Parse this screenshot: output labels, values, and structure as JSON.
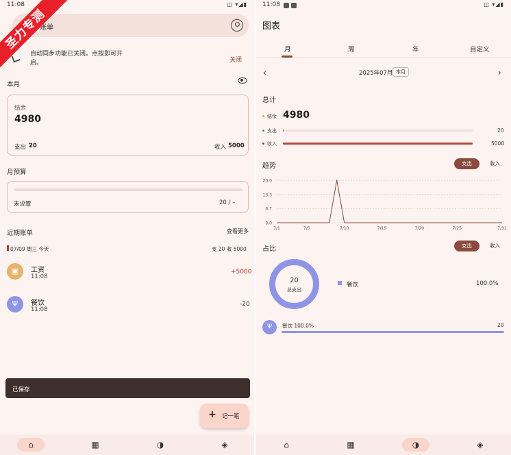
{
  "left": {
    "status_time": "11:08",
    "status_icons": "◫ ▾◢▮",
    "ribbon": "圣力专测",
    "search_text": "账单",
    "sync_note": "自动同步功能已关闭。点按即可开启。",
    "sync_close": "关闭",
    "this_month": "本月",
    "balance": {
      "label": "结余",
      "value": "4980",
      "expense_label": "支出",
      "expense_value": "20",
      "income_label": "收入",
      "income_value": "5000"
    },
    "budget": {
      "title": "月预算",
      "status": "未设置",
      "value": "20 / –",
      "progress": 0
    },
    "recent": {
      "title": "近期账单",
      "see_more": "查看更多",
      "day": "07/09 周三 今天",
      "day_summary": "支 20   收 5000"
    },
    "transactions": [
      {
        "icon": "wallet-icon",
        "glyph": "▣",
        "color": "#e7b36b",
        "name": "工资",
        "time": "11:08",
        "amount": "+5000",
        "amount_color": "#b3322f"
      },
      {
        "icon": "fork-knife-icon",
        "glyph": "Ψ",
        "color": "#8f95e6",
        "name": "餐饮",
        "time": "11:08",
        "amount": "-20",
        "amount_color": "#333333"
      }
    ],
    "snackbar": "已保存",
    "fab": {
      "plus": "+",
      "label": "记一笔"
    },
    "nav": [
      {
        "icon": "home-icon",
        "glyph": "⌂"
      },
      {
        "icon": "calendar-icon",
        "glyph": "▦"
      },
      {
        "icon": "chart-icon",
        "glyph": "◑"
      },
      {
        "icon": "layers-icon",
        "glyph": "◈"
      }
    ]
  },
  "right": {
    "status_time": "11:08",
    "status_icons": "◫ ▾◢▮",
    "title": "图表",
    "tabs": [
      {
        "label": "月",
        "active": true
      },
      {
        "label": "周",
        "active": false
      },
      {
        "label": "年",
        "active": false
      },
      {
        "label": "自定义",
        "active": false
      }
    ],
    "month_label": "2025年07月",
    "this_month_btn": "本月",
    "prev_glyph": "‹",
    "next_glyph": "›",
    "total": {
      "title": "总计",
      "balance_label": "结余",
      "balance_value": "4980",
      "expense_label": "支出",
      "expense_value": "20",
      "expense_ratio": 0.004,
      "income_label": "收入",
      "income_value": "5000",
      "income_ratio": 1.0
    },
    "trend": {
      "title": "趋势",
      "pill_on": "支出",
      "pill_off": "收入"
    },
    "share": {
      "title": "占比",
      "pill_on": "支出",
      "pill_off": "收入",
      "donut_value": "20",
      "donut_label": "总支出",
      "legend_name": "餐饮",
      "legend_pct": "100.0%",
      "cat_label": "餐饮  100.0%",
      "cat_value": "20"
    },
    "nav": [
      {
        "icon": "home-icon",
        "glyph": "⌂"
      },
      {
        "icon": "calendar-icon",
        "glyph": "▦"
      },
      {
        "icon": "chart-icon",
        "glyph": "◑"
      },
      {
        "icon": "layers-icon",
        "glyph": "◈"
      }
    ]
  },
  "chart_data": {
    "type": "line",
    "x": [
      "7/1",
      "7/2",
      "7/3",
      "7/4",
      "7/5",
      "7/6",
      "7/7",
      "7/8",
      "7/9",
      "7/10",
      "7/11",
      "7/12",
      "7/13",
      "7/14",
      "7/15",
      "7/16",
      "7/17",
      "7/18",
      "7/19",
      "7/20",
      "7/21",
      "7/22",
      "7/23",
      "7/24",
      "7/25",
      "7/26",
      "7/27",
      "7/28",
      "7/29",
      "7/30",
      "7/31"
    ],
    "values": [
      0,
      0,
      0,
      0,
      0,
      0,
      0,
      0,
      20,
      0,
      0,
      0,
      0,
      0,
      0,
      0,
      0,
      0,
      0,
      0,
      0,
      0,
      0,
      0,
      0,
      0,
      0,
      0,
      0,
      0,
      0
    ],
    "xticks": [
      "7/1",
      "7/5",
      "7/10",
      "7/15",
      "7/20",
      "7/25",
      "7/31"
    ],
    "yticks": [
      "0.0",
      "6.7",
      "13.3",
      "20.0"
    ],
    "ylim": [
      0,
      20
    ],
    "color": "#8b4a3e"
  }
}
